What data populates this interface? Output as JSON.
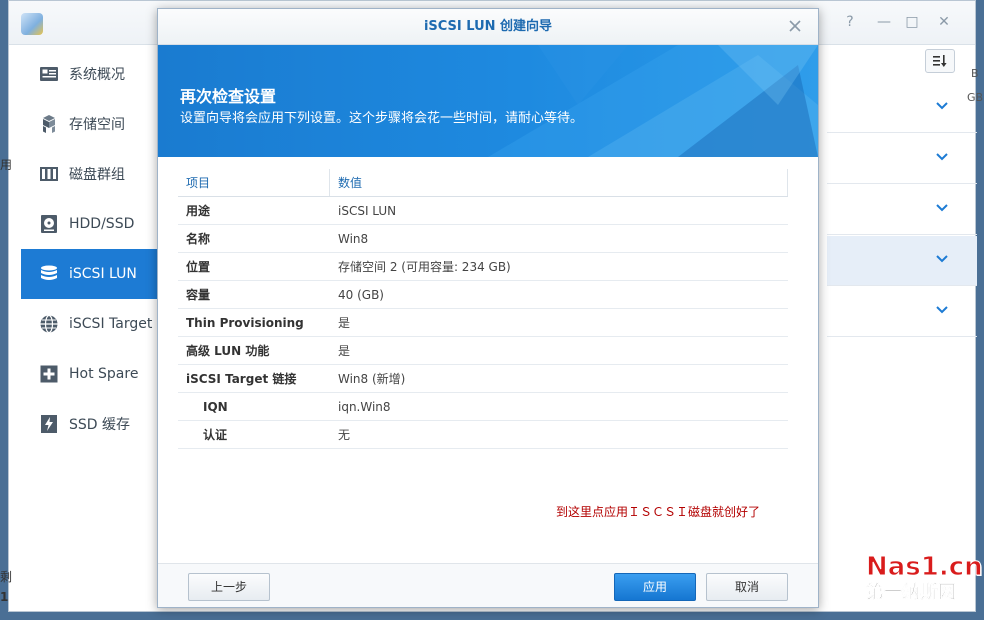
{
  "background_window": {
    "sidebar": {
      "items": [
        {
          "label": "系统概况",
          "icon": "overview-icon"
        },
        {
          "label": "存储空间",
          "icon": "volume-icon"
        },
        {
          "label": "磁盘群组",
          "icon": "disk-group-icon"
        },
        {
          "label": "HDD/SSD",
          "icon": "hdd-icon"
        },
        {
          "label": "iSCSI LUN",
          "icon": "lun-icon",
          "active": true
        },
        {
          "label": "iSCSI Target",
          "icon": "globe-icon"
        },
        {
          "label": "Hot Spare",
          "icon": "plus-box-icon"
        },
        {
          "label": "SSD 缓存",
          "icon": "lightning-icon"
        }
      ]
    },
    "left_fragments": [
      "用",
      "剩",
      "1"
    ],
    "right_fragments": [
      "B",
      "GB"
    ],
    "controls": {
      "help": "?",
      "minimize": "—",
      "maximize": "□",
      "close": "✕"
    }
  },
  "dialog": {
    "title": "iSCSI LUN 创建向导",
    "banner": {
      "heading": "再次检查设置",
      "subtitle": "设置向导将会应用下列设置。这个步骤将会花一些时间，请耐心等待。"
    },
    "columns": {
      "item": "项目",
      "value": "数值"
    },
    "rows": [
      {
        "key": "用途",
        "value": "iSCSI LUN"
      },
      {
        "key": "名称",
        "value": "Win8"
      },
      {
        "key": "位置",
        "value": "存储空间 2 (可用容量: 234 GB)"
      },
      {
        "key": "容量",
        "value": "40 (GB)"
      },
      {
        "key": "Thin Provisioning",
        "value": "是"
      },
      {
        "key": "高级 LUN 功能",
        "value": "是"
      },
      {
        "key": "iSCSI Target 链接",
        "value": "Win8 (新增)"
      },
      {
        "key": "IQN",
        "value": "iqn.Win8"
      },
      {
        "key": "认证",
        "value": "无"
      }
    ],
    "annotation": "到这里点应用ＩＳＣＳＩ磁盘就创好了",
    "buttons": {
      "back": "上一步",
      "apply": "应用",
      "cancel": "取消"
    }
  },
  "watermark": {
    "line1": "Nas1.cn",
    "line2": "第一纳斯网"
  },
  "colors": {
    "accent": "#1d7bd4",
    "banner": "#1a7bd0",
    "annotation": "#b30000",
    "watermark": "#d91c1c"
  }
}
